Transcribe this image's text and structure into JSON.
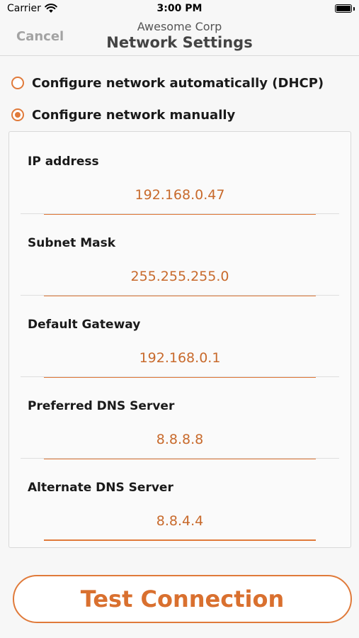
{
  "status_bar": {
    "carrier": "Carrier",
    "time": "3:00 PM",
    "battery_level": 1.0
  },
  "nav": {
    "cancel_label": "Cancel",
    "subtitle": "Awesome Corp",
    "title": "Network Settings"
  },
  "config_options": [
    {
      "label": "Configure network automatically (DHCP)",
      "selected": false
    },
    {
      "label": "Configure network manually",
      "selected": true
    }
  ],
  "fields": [
    {
      "label": "IP address",
      "value": "192.168.0.47"
    },
    {
      "label": "Subnet Mask",
      "value": "255.255.255.0"
    },
    {
      "label": "Default Gateway",
      "value": "192.168.0.1"
    },
    {
      "label": "Preferred DNS Server",
      "value": "8.8.8.8"
    },
    {
      "label": "Alternate DNS Server",
      "value": "8.8.4.4"
    }
  ],
  "test_button_label": "Test Connection",
  "colors": {
    "accent": "#e07a3a",
    "value_text": "#c86a2c",
    "cancel": "#a3a3a3"
  },
  "icons": {
    "wifi": "wifi-icon",
    "battery": "battery-icon"
  }
}
